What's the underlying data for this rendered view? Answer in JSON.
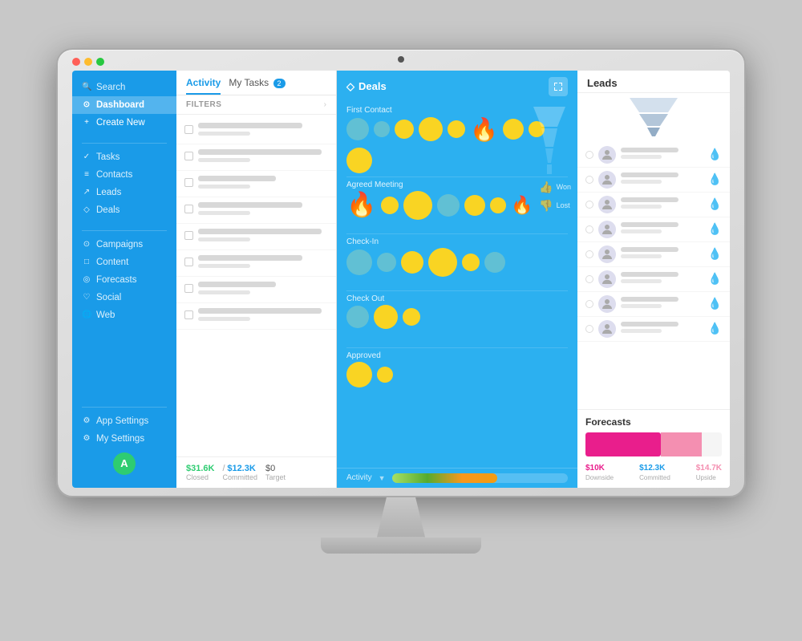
{
  "monitor": {
    "traffic_lights": [
      "red",
      "yellow",
      "green"
    ]
  },
  "sidebar": {
    "search_label": "Search",
    "dashboard_label": "Dashboard",
    "create_label": "Create New",
    "nav_items": [
      {
        "label": "Tasks",
        "icon": "✓"
      },
      {
        "label": "Contacts",
        "icon": "≡"
      },
      {
        "label": "Leads",
        "icon": "↗"
      },
      {
        "label": "Deals",
        "icon": "◇"
      }
    ],
    "tools_items": [
      {
        "label": "Campaigns",
        "icon": "⊙"
      },
      {
        "label": "Content",
        "icon": "□"
      },
      {
        "label": "Forecasts",
        "icon": "◎"
      },
      {
        "label": "Social",
        "icon": "♡"
      },
      {
        "label": "Web",
        "icon": "🌐"
      }
    ],
    "settings_items": [
      {
        "label": "App Settings",
        "icon": "⚙"
      },
      {
        "label": "My Settings",
        "icon": "⚙"
      }
    ],
    "avatar_label": "A"
  },
  "activity": {
    "tab_activity": "Activity",
    "tab_tasks": "My Tasks",
    "task_badge": "2",
    "filters_label": "FILTERS",
    "footer": {
      "closed_value": "$31.6K",
      "closed_label": "Closed",
      "committed_value": "$12.3K",
      "committed_label": "Committed",
      "target_value": "$0",
      "target_label": "Target"
    }
  },
  "deals": {
    "title": "Deals",
    "title_icon": "◇",
    "stages": [
      {
        "label": "First Contact"
      },
      {
        "label": "Agreed Meeting"
      },
      {
        "label": "Check-In"
      },
      {
        "label": "Check Out"
      },
      {
        "label": "Approved"
      }
    ],
    "won_label": "Won",
    "lost_label": "Lost",
    "footer_label": "Activity",
    "activity_bar_width": "60%"
  },
  "leads": {
    "title": "Leads",
    "drop_icon": "💧",
    "lead_count": 8,
    "forecasts": {
      "title": "Forecasts",
      "downside_value": "$10K",
      "downside_label": "Downside",
      "committed_value": "$12.3K",
      "committed_label": "Committed",
      "upside_value": "$14.7K",
      "upside_label": "Upside"
    }
  }
}
